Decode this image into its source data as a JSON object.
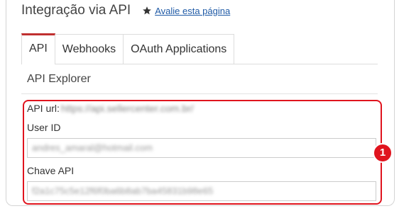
{
  "header": {
    "title": "Integração via API",
    "rate_icon": "star-icon",
    "rate_link": "Avalie esta página"
  },
  "tabs": [
    {
      "label": "API",
      "active": true
    },
    {
      "label": "Webhooks",
      "active": false
    },
    {
      "label": "OAuth Applications",
      "active": false
    }
  ],
  "section": {
    "title": "API Explorer"
  },
  "form": {
    "api_url_label": "API url:",
    "api_url_value": "https://api.sellercenter.com.br/",
    "user_id_label": "User ID",
    "user_id_value": "andres_amaral@hotmail.com",
    "api_key_label": "Chave API",
    "api_key_value": "f2a1c75c5e12f6f0ba6b8ab7ba45831b98e65"
  },
  "annotation": {
    "badge_number": "1",
    "highlight_color": "#e0141e"
  },
  "colors": {
    "active_tab_accent": "#c03030",
    "link": "#1f5aa6"
  }
}
